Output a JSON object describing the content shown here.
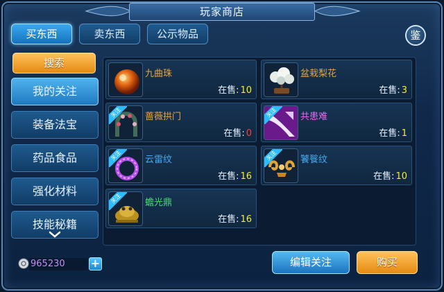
{
  "window": {
    "title": "玩家商店",
    "close_label": "鉴"
  },
  "tabs": [
    {
      "label": "买东西",
      "active": true
    },
    {
      "label": "卖东西",
      "active": false
    },
    {
      "label": "公示物品",
      "active": false
    }
  ],
  "sidebar": {
    "search_label": "搜索",
    "items": [
      {
        "label": "我的关注",
        "active": true
      },
      {
        "label": "装备法宝",
        "active": false
      },
      {
        "label": "药品食品",
        "active": false
      },
      {
        "label": "强化材料",
        "active": false
      },
      {
        "label": "技能秘籍",
        "active": false
      }
    ],
    "more_icon": "chevron-down-icon"
  },
  "items": [
    {
      "name": "九曲珠",
      "stock_label": "在售:",
      "stock": "10",
      "color": "#e7a43d",
      "icon": "orange-orb-icon",
      "favorite": false
    },
    {
      "name": "盆栽梨花",
      "stock_label": "在售:",
      "stock": "3",
      "color": "#e7a43d",
      "icon": "potted-pear-blossom-icon",
      "favorite": false
    },
    {
      "name": "蔷薇拱门",
      "stock_label": "在售:",
      "stock": "0",
      "color": "#e7a43d",
      "icon": "rose-arch-icon",
      "favorite": true
    },
    {
      "name": "共患难",
      "stock_label": "在售:",
      "stock": "1",
      "color": "#e46cf2",
      "icon": "purple-emblem-icon",
      "favorite": true
    },
    {
      "name": "云雷纹",
      "stock_label": "在售:",
      "stock": "16",
      "color": "#47a8ee",
      "icon": "purple-ring-icon",
      "favorite": true
    },
    {
      "name": "饕餮纹",
      "stock_label": "在售:",
      "stock": "10",
      "color": "#47a8ee",
      "icon": "golden-pattern-icon",
      "favorite": true
    },
    {
      "name": "蟾光鼎",
      "stock_label": "在售:",
      "stock": "16",
      "color": "#45e06e",
      "icon": "golden-toad-icon",
      "favorite": true
    }
  ],
  "favorite_badge": "关注",
  "footer": {
    "money": "965230",
    "add_label": "+",
    "edit_label": "编辑关注",
    "buy_label": "购买"
  }
}
